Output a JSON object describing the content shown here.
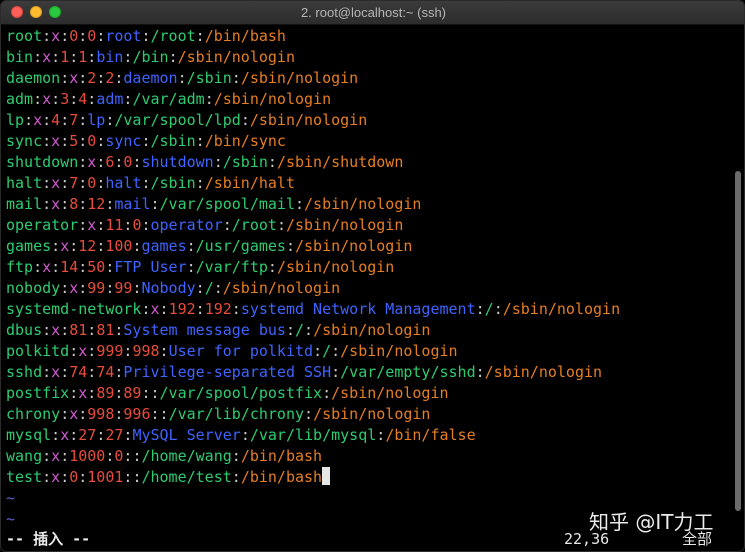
{
  "window": {
    "title": "2. root@localhost:~ (ssh)"
  },
  "colors": {
    "name": "#2ecc71",
    "sep": "#c9c9c9",
    "x": "#d25cd2",
    "uid": "#e74c3c",
    "gid": "#e74c3c",
    "gecos": "#3f63ff",
    "home": "#2ecc71",
    "shell": "#e67e22"
  },
  "lines": [
    {
      "name": "root",
      "x": "x",
      "uid": "0",
      "gid": "0",
      "gecos": "root",
      "home": "/root",
      "shell": "/bin/bash"
    },
    {
      "name": "bin",
      "x": "x",
      "uid": "1",
      "gid": "1",
      "gecos": "bin",
      "home": "/bin",
      "shell": "/sbin/nologin"
    },
    {
      "name": "daemon",
      "x": "x",
      "uid": "2",
      "gid": "2",
      "gecos": "daemon",
      "home": "/sbin",
      "shell": "/sbin/nologin"
    },
    {
      "name": "adm",
      "x": "x",
      "uid": "3",
      "gid": "4",
      "gecos": "adm",
      "home": "/var/adm",
      "shell": "/sbin/nologin"
    },
    {
      "name": "lp",
      "x": "x",
      "uid": "4",
      "gid": "7",
      "gecos": "lp",
      "home": "/var/spool/lpd",
      "shell": "/sbin/nologin"
    },
    {
      "name": "sync",
      "x": "x",
      "uid": "5",
      "gid": "0",
      "gecos": "sync",
      "home": "/sbin",
      "shell": "/bin/sync"
    },
    {
      "name": "shutdown",
      "x": "x",
      "uid": "6",
      "gid": "0",
      "gecos": "shutdown",
      "home": "/sbin",
      "shell": "/sbin/shutdown"
    },
    {
      "name": "halt",
      "x": "x",
      "uid": "7",
      "gid": "0",
      "gecos": "halt",
      "home": "/sbin",
      "shell": "/sbin/halt"
    },
    {
      "name": "mail",
      "x": "x",
      "uid": "8",
      "gid": "12",
      "gecos": "mail",
      "home": "/var/spool/mail",
      "shell": "/sbin/nologin"
    },
    {
      "name": "operator",
      "x": "x",
      "uid": "11",
      "gid": "0",
      "gecos": "operator",
      "home": "/root",
      "shell": "/sbin/nologin"
    },
    {
      "name": "games",
      "x": "x",
      "uid": "12",
      "gid": "100",
      "gecos": "games",
      "home": "/usr/games",
      "shell": "/sbin/nologin"
    },
    {
      "name": "ftp",
      "x": "x",
      "uid": "14",
      "gid": "50",
      "gecos": "FTP User",
      "home": "/var/ftp",
      "shell": "/sbin/nologin"
    },
    {
      "name": "nobody",
      "x": "x",
      "uid": "99",
      "gid": "99",
      "gecos": "Nobody",
      "home": "/",
      "shell": "/sbin/nologin"
    },
    {
      "name": "systemd-network",
      "x": "x",
      "uid": "192",
      "gid": "192",
      "gecos": "systemd Network Management",
      "home": "/",
      "shell": "/sbin/nologin"
    },
    {
      "name": "dbus",
      "x": "x",
      "uid": "81",
      "gid": "81",
      "gecos": "System message bus",
      "home": "/",
      "shell": "/sbin/nologin"
    },
    {
      "name": "polkitd",
      "x": "x",
      "uid": "999",
      "gid": "998",
      "gecos": "User for polkitd",
      "home": "/",
      "shell": "/sbin/nologin"
    },
    {
      "name": "sshd",
      "x": "x",
      "uid": "74",
      "gid": "74",
      "gecos": "Privilege-separated SSH",
      "home": "/var/empty/sshd",
      "shell": "/sbin/nologin"
    },
    {
      "name": "postfix",
      "x": "x",
      "uid": "89",
      "gid": "89",
      "gecos": "",
      "home": "/var/spool/postfix",
      "shell": "/sbin/nologin"
    },
    {
      "name": "chrony",
      "x": "x",
      "uid": "998",
      "gid": "996",
      "gecos": "",
      "home": "/var/lib/chrony",
      "shell": "/sbin/nologin"
    },
    {
      "name": "mysql",
      "x": "x",
      "uid": "27",
      "gid": "27",
      "gecos": "MySQL Server",
      "home": "/var/lib/mysql",
      "shell": "/bin/false"
    },
    {
      "name": "wang",
      "x": "x",
      "uid": "1000",
      "gid": "0",
      "gecos": "",
      "home": "/home/wang",
      "shell": "/bin/bash"
    },
    {
      "name": "test",
      "x": "x",
      "uid": "0",
      "gid": "1001",
      "gecos": "",
      "home": "/home/test",
      "shell": "/bin/bash"
    }
  ],
  "empty_lines": [
    "~",
    "~"
  ],
  "statusbar": {
    "mode": "-- 插入 --",
    "position": "22,36",
    "scroll": "全部"
  },
  "watermark": "知乎 @IT力工"
}
